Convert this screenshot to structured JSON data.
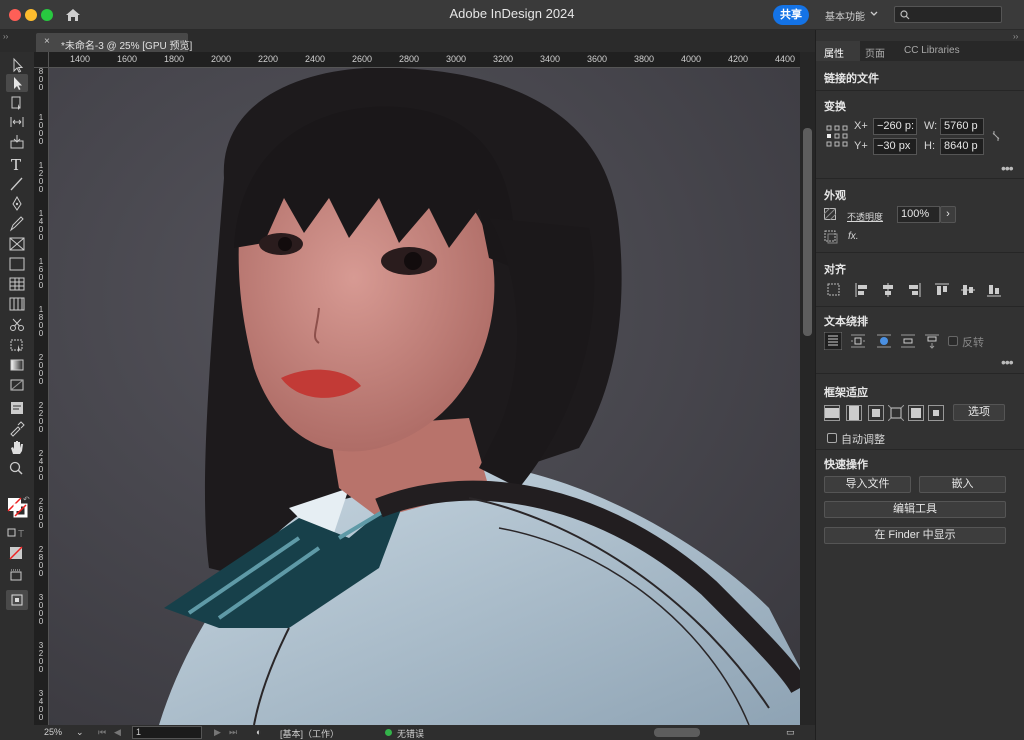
{
  "window": {
    "title": "Adobe InDesign 2024",
    "share_label": "共享",
    "workspace_label": "基本功能",
    "search_placeholder": ""
  },
  "document_tab": {
    "title": "*未命名-3 @ 25% [GPU 预览]",
    "close_glyph": "×"
  },
  "ruler": {
    "horizontal": [
      "1400",
      "1600",
      "1800",
      "2000",
      "2200",
      "2400",
      "2600",
      "2800",
      "3000",
      "3200",
      "3400",
      "3600",
      "3800",
      "4000",
      "4200",
      "4400"
    ],
    "vertical": [
      "1000",
      "1200",
      "1400",
      "1600",
      "1800",
      "2000",
      "2200",
      "2400",
      "2600",
      "2800",
      "3000",
      "3200",
      "3400"
    ],
    "corner_label": "800"
  },
  "status": {
    "zoom": "25%",
    "page": "1",
    "style": "[基本]（工作）",
    "errors": "无错误"
  },
  "panel": {
    "tabs": [
      "属性",
      "页面",
      "CC Libraries"
    ],
    "linked_file_heading": "链接的文件",
    "transform_heading": "变换",
    "x_label": "X+",
    "y_label": "Y+",
    "x_value": "−260 p:",
    "y_value": "−30 px",
    "w_label": "W:",
    "h_label": "H:",
    "w_value": "5760 p",
    "h_value": "8640 p",
    "appearance_heading": "外观",
    "opacity_label": "不透明度",
    "opacity_value": "100%",
    "fx_label": "fx.",
    "align_heading": "对齐",
    "wrap_heading": "文本绕排",
    "invert_label": "反转",
    "fitting_heading": "框架适应",
    "fitting_options": "选项",
    "auto_fit": "自动调整",
    "quick_actions_heading": "快速操作",
    "import_file": "导入文件",
    "embed": "嵌入",
    "edit_tool": "编辑工具",
    "show_in_finder": "在 Finder 中显示"
  },
  "colors": {
    "accent": "#1473e6",
    "panel_bg": "#323232",
    "canvas_bg": "#45434a",
    "no_error": "#33b34a"
  },
  "icons": [
    "home-icon",
    "search-icon",
    "selection-tool-icon",
    "direct-selection-tool-icon",
    "page-tool-icon",
    "gap-tool-icon",
    "content-collector-icon",
    "type-tool-icon",
    "line-tool-icon",
    "pen-tool-icon",
    "pencil-tool-icon",
    "rectangle-frame-tool-icon",
    "rectangle-tool-icon",
    "table-tool-icon",
    "scissors-tool-icon",
    "free-transform-tool-icon",
    "gradient-swatch-tool-icon",
    "gradient-feather-tool-icon",
    "note-tool-icon",
    "eyedropper-tool-icon",
    "hand-tool-icon",
    "zoom-tool-icon",
    "fill-stroke-icon",
    "screen-mode-icon"
  ]
}
